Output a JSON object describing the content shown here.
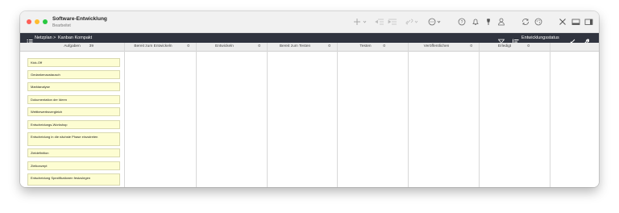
{
  "window": {
    "title": "Software-Entwicklung",
    "subtitle": "Bearbeitet"
  },
  "toolbar": {
    "icons": [
      "add-icon",
      "chevron-down-icon",
      "outdent-icon",
      "indent-icon",
      "link-icon",
      "chevron-down-icon",
      "more-icon",
      "chevron-down-icon",
      "help-icon",
      "bell-icon",
      "pin-icon",
      "person-icon",
      "sync-icon",
      "palette-icon",
      "tools-icon",
      "panel-bottom-icon",
      "panel-right-icon"
    ]
  },
  "navbar": {
    "breadcrumb_root": "Netzplan",
    "separator": ">",
    "breadcrumb_current": "Kanban Kompakt",
    "status_label": "Entwicklungsstatus"
  },
  "columns": [
    {
      "title": "Aufgaben",
      "count": "39"
    },
    {
      "title": "Bereit zum Entwickeln",
      "count": "0"
    },
    {
      "title": "Entwickeln",
      "count": "0"
    },
    {
      "title": "Bereit zum Testen",
      "count": "0"
    },
    {
      "title": "Testen",
      "count": "0"
    },
    {
      "title": "Veröffentlichen",
      "count": "0"
    },
    {
      "title": "Erledigt",
      "count": "0"
    }
  ],
  "cards": [
    "Kick-Off",
    "Gedankenaustausch",
    "Marktanalyse",
    "Dokumentation der Ideen",
    "Wettbewerbsvergleich",
    "Entscheidungs-Workshop",
    "Entscheidung in die nächste Phase einzutreten",
    "Zieldefinition",
    "Zielkonzept",
    "Entscheidung Spezifikationen festzulegen"
  ]
}
